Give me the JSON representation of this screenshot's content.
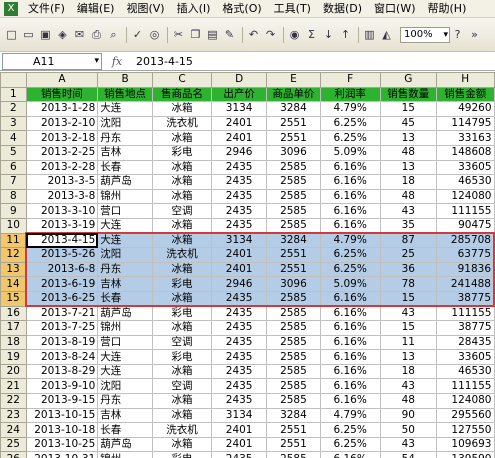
{
  "menu": {
    "items": [
      "文件(F)",
      "编辑(E)",
      "视图(V)",
      "插入(I)",
      "格式(O)",
      "工具(T)",
      "数据(D)",
      "窗口(W)",
      "帮助(H)"
    ]
  },
  "toolbar": {
    "zoom": "100%"
  },
  "formula_bar": {
    "name_box": "A11",
    "fx_label": "fx",
    "content": "2013-4-15"
  },
  "columns": [
    "A",
    "B",
    "C",
    "D",
    "E",
    "F",
    "G",
    "H"
  ],
  "header_row": [
    "销售时间",
    "销售地点",
    "商品名称",
    "出产价",
    "商品单价",
    "利润率",
    "销售数量",
    "销售金额"
  ],
  "header_row_display": [
    "销售时间",
    "销售地点",
    "售商品名",
    "出产价",
    "商品单价",
    "利润率",
    "销售数量",
    "销售金额"
  ],
  "rows": [
    [
      "2013-1-28",
      "大连",
      "冰箱",
      "3134",
      "3284",
      "4.79%",
      "15",
      "49260"
    ],
    [
      "2013-2-10",
      "沈阳",
      "洗衣机",
      "2401",
      "2551",
      "6.25%",
      "45",
      "114795"
    ],
    [
      "2013-2-18",
      "丹东",
      "冰箱",
      "2401",
      "2551",
      "6.25%",
      "13",
      "33163"
    ],
    [
      "2013-2-25",
      "吉林",
      "彩电",
      "2946",
      "3096",
      "5.09%",
      "48",
      "148608"
    ],
    [
      "2013-2-28",
      "长春",
      "冰箱",
      "2435",
      "2585",
      "6.16%",
      "13",
      "33605"
    ],
    [
      "2013-3-5",
      "葫芦岛",
      "冰箱",
      "2435",
      "2585",
      "6.16%",
      "18",
      "46530"
    ],
    [
      "2013-3-8",
      "锦州",
      "冰箱",
      "2435",
      "2585",
      "6.16%",
      "48",
      "124080"
    ],
    [
      "2013-3-10",
      "营口",
      "空调",
      "2435",
      "2585",
      "6.16%",
      "43",
      "111155"
    ],
    [
      "2013-3-19",
      "大连",
      "冰箱",
      "2435",
      "2585",
      "6.16%",
      "35",
      "90475"
    ],
    [
      "2013-4-15",
      "大连",
      "冰箱",
      "3134",
      "3284",
      "4.79%",
      "87",
      "285708"
    ],
    [
      "2013-5-26",
      "沈阳",
      "洗衣机",
      "2401",
      "2551",
      "6.25%",
      "25",
      "63775"
    ],
    [
      "2013-6-8",
      "丹东",
      "冰箱",
      "2401",
      "2551",
      "6.25%",
      "36",
      "91836"
    ],
    [
      "2013-6-19",
      "吉林",
      "彩电",
      "2946",
      "3096",
      "5.09%",
      "78",
      "241488"
    ],
    [
      "2013-6-25",
      "长春",
      "冰箱",
      "2435",
      "2585",
      "6.16%",
      "15",
      "38775"
    ],
    [
      "2013-7-21",
      "葫芦岛",
      "彩电",
      "2435",
      "2585",
      "6.16%",
      "43",
      "111155"
    ],
    [
      "2013-7-25",
      "锦州",
      "冰箱",
      "2435",
      "2585",
      "6.16%",
      "15",
      "38775"
    ],
    [
      "2013-8-19",
      "营口",
      "空调",
      "2435",
      "2585",
      "6.16%",
      "11",
      "28435"
    ],
    [
      "2013-8-24",
      "大连",
      "彩电",
      "2435",
      "2585",
      "6.16%",
      "13",
      "33605"
    ],
    [
      "2013-8-29",
      "大连",
      "冰箱",
      "2435",
      "2585",
      "6.16%",
      "18",
      "46530"
    ],
    [
      "2013-9-10",
      "沈阳",
      "空调",
      "2435",
      "2585",
      "6.16%",
      "43",
      "111155"
    ],
    [
      "2013-9-15",
      "丹东",
      "冰箱",
      "2435",
      "2585",
      "6.16%",
      "48",
      "124080"
    ],
    [
      "2013-10-15",
      "吉林",
      "冰箱",
      "3134",
      "3284",
      "4.79%",
      "90",
      "295560"
    ],
    [
      "2013-10-18",
      "长春",
      "洗衣机",
      "2401",
      "2551",
      "6.25%",
      "50",
      "127550"
    ],
    [
      "2013-10-25",
      "葫芦岛",
      "冰箱",
      "2401",
      "2551",
      "6.25%",
      "43",
      "109693"
    ],
    [
      "2013-10-31",
      "锦州",
      "彩电",
      "2435",
      "2585",
      "6.16%",
      "54",
      "139590"
    ]
  ],
  "selection": {
    "first_row": 11,
    "last_row": 15
  },
  "colors": {
    "header_green": "#2db32f",
    "selection_blue": "#b5cce6",
    "selection_border": "#d23a3a"
  }
}
